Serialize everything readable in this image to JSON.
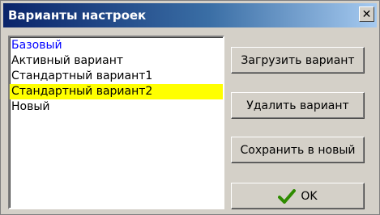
{
  "window": {
    "title": "Варианты настроек",
    "close_glyph": "✕"
  },
  "list": {
    "items": [
      {
        "label": "Базовый",
        "color": "#0000ff"
      },
      {
        "label": "Активный вариант"
      },
      {
        "label": "Стандартный вариант1"
      },
      {
        "label": "Стандартный вариант2",
        "selected": true
      },
      {
        "label": "Новый"
      }
    ],
    "selected_color": "#ffff00"
  },
  "buttons": {
    "load": "Загрузить вариант",
    "delete": "Удалить вариант",
    "save_new": "Сохранить в новый",
    "ok": "OK",
    "ok_icon": "check-icon"
  },
  "colors": {
    "check": "#2e8b00",
    "title_bar": "#0a246a"
  }
}
